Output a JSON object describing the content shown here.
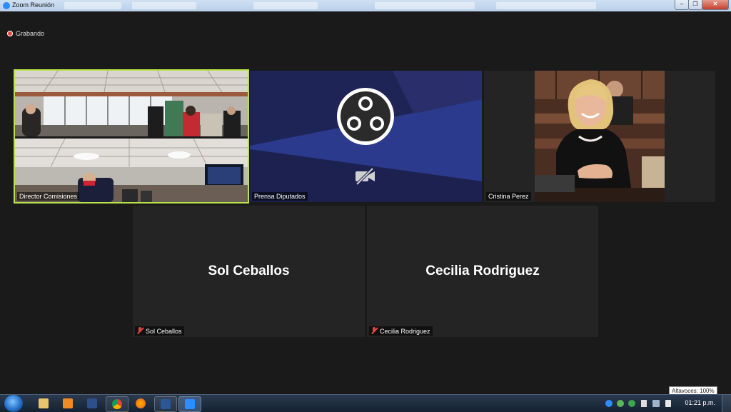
{
  "window": {
    "title": "Zoom Reunión"
  },
  "recording": {
    "label": "Grabando"
  },
  "participants": [
    {
      "name": "Director Comisiones",
      "video": true
    },
    {
      "name": "Prensa Diputados",
      "video": false,
      "logo": "obs-logo"
    },
    {
      "name": "Cristina Perez",
      "video": true
    },
    {
      "name": "Sol Ceballos",
      "video": false,
      "muted": true,
      "display_name": "Sol Ceballos"
    },
    {
      "name": "Cecilia Rodriguez",
      "video": false,
      "muted": true,
      "display_name": "Cecilia Rodriguez"
    }
  ],
  "taskbar": {
    "clock": "01:21 p.m.",
    "tooltip": "Altavoces: 100%"
  },
  "colors": {
    "active_speaker": "#b8e34a",
    "muted": "#e0463a",
    "zoom_blue": "#2d8cff"
  }
}
